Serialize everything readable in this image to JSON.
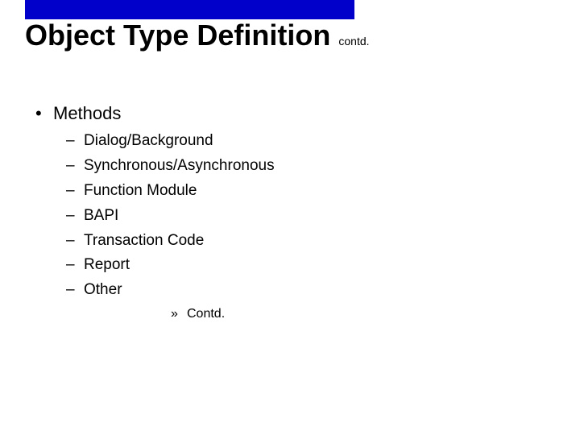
{
  "title": {
    "main": "Object Type Definition",
    "suffix": "contd."
  },
  "bullets": {
    "level1": "Methods",
    "level2": [
      "Dialog/Background",
      "Synchronous/Asynchronous",
      "Function Module",
      "BAPI",
      "Transaction Code",
      "Report",
      "Other"
    ],
    "level3": "Contd."
  }
}
